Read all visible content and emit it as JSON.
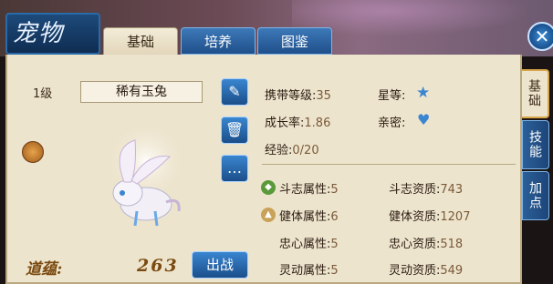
{
  "header": {
    "logo_text": "宠物",
    "tabs": [
      {
        "label": "基础",
        "active": true
      },
      {
        "label": "培养",
        "active": false
      },
      {
        "label": "图鉴",
        "active": false
      }
    ],
    "close_symbol": "✕"
  },
  "side_tabs": [
    {
      "label": "基础",
      "active": true
    },
    {
      "label": "技能",
      "active": false
    },
    {
      "label": "加点",
      "active": false
    }
  ],
  "pet": {
    "level": "1级",
    "name": "稀有玉兔"
  },
  "tools": {
    "rename_symbol": "✎",
    "release_symbol": "🗑",
    "chat_symbol": "…"
  },
  "stats": {
    "carry_level_label": "携带等级:",
    "carry_level": "35",
    "growth_label": "成长率:",
    "growth": "1.86",
    "exp_label": "经验:",
    "exp": "0/20",
    "star_label": "星等:",
    "intimacy_label": "亲密:"
  },
  "attributes": [
    {
      "label": "斗志属性:",
      "value": "5",
      "apt_label": "斗志资质:",
      "apt": "743"
    },
    {
      "label": "健体属性:",
      "value": "6",
      "apt_label": "健体资质:",
      "apt": "1207"
    },
    {
      "label": "忠心属性:",
      "value": "5",
      "apt_label": "忠心资质:",
      "apt": "518"
    },
    {
      "label": "灵动属性:",
      "value": "5",
      "apt_label": "灵动资质:",
      "apt": "549"
    }
  ],
  "footer": {
    "daoyun_label": "道蕴:",
    "daoyun_value": "263",
    "fight_button": "出战"
  },
  "icons": {
    "star": "star-icon",
    "heart": "heart-icon",
    "lock": "lock-icon"
  },
  "colors": {
    "accent_blue": "#2a6aa8",
    "panel_bg": "#ede4cd",
    "value_brown": "#7a5a3a"
  }
}
